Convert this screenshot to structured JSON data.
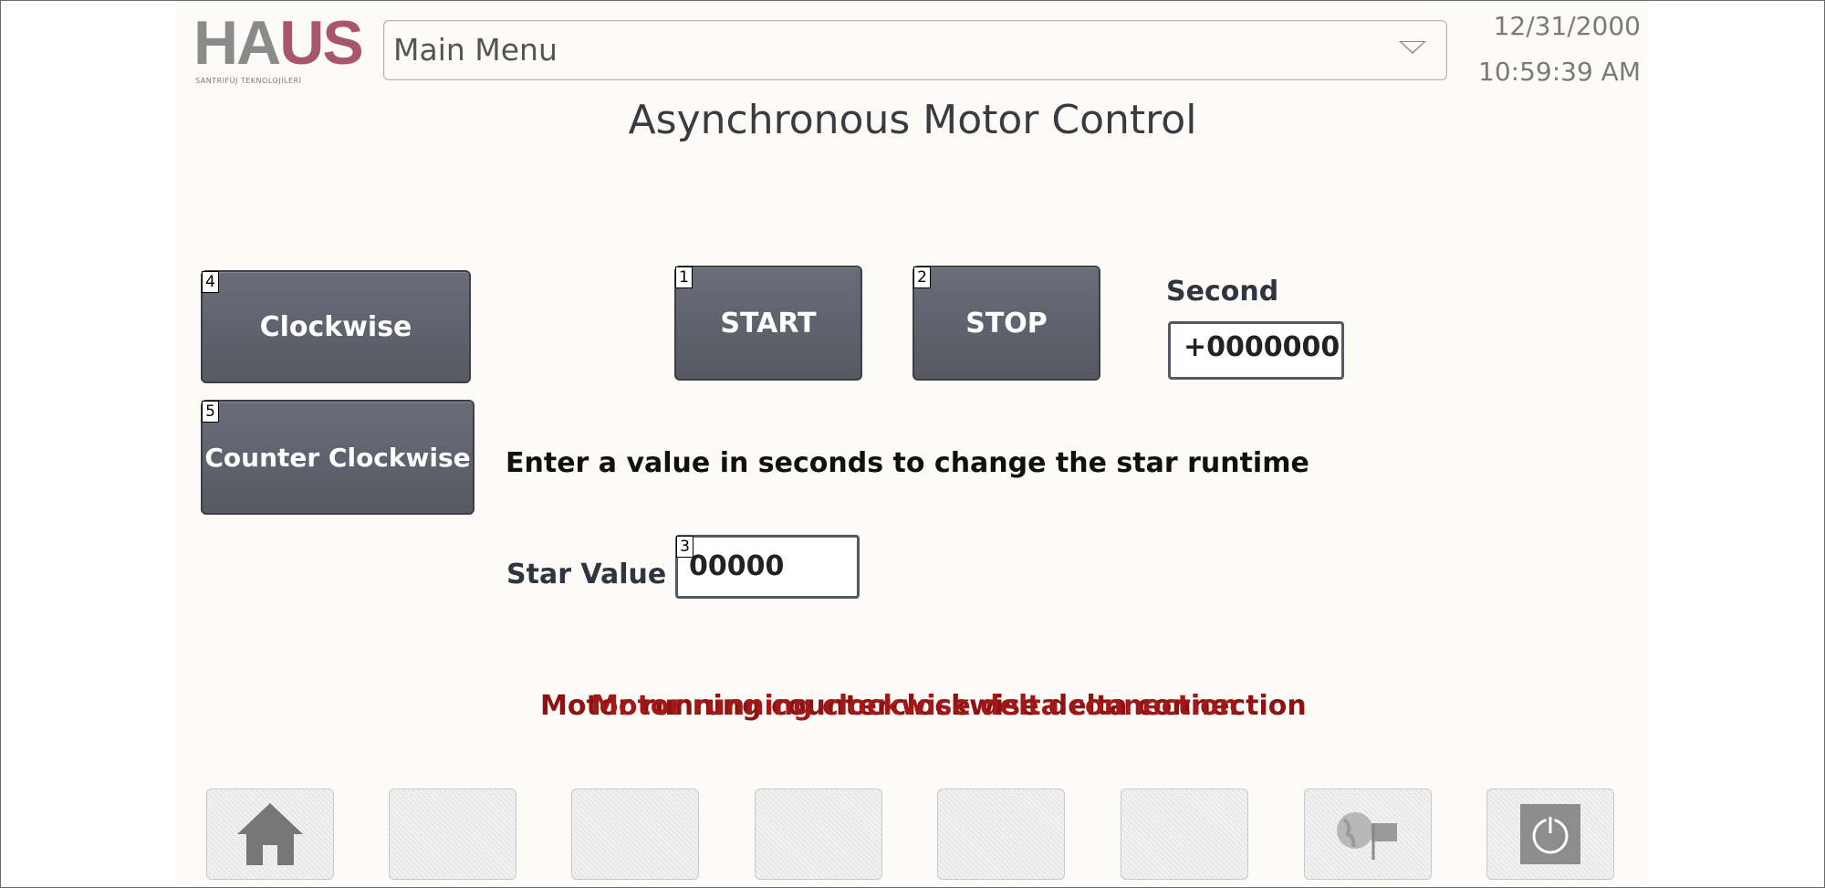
{
  "header": {
    "logo_text_a": "HA",
    "logo_text_b": "US",
    "logo_subtitle": "SANTRIFÜJ TEKNOLOJİLERİ",
    "menu_label": "Main Menu",
    "date": "12/31/2000",
    "time": "10:59:39 AM"
  },
  "title": "Asynchronous Motor Control",
  "buttons": {
    "clockwise": {
      "label": "Clockwise",
      "tag": "4"
    },
    "counter_clockwise": {
      "label": "Counter Clockwise",
      "tag": "5"
    },
    "start": {
      "label": "START",
      "tag": "1"
    },
    "stop": {
      "label": "STOP",
      "tag": "2"
    }
  },
  "second": {
    "label": "Second",
    "value": "+0000000"
  },
  "instruction": "Enter a value in seconds to change the star runtime",
  "star": {
    "label": "Star Value",
    "value": "00000",
    "tag": "3"
  },
  "status": {
    "line_a": "Motor running counterclockwise delta connection",
    "line_b": "Motor running clockwise delta connection"
  },
  "nav_icons": [
    "home-icon",
    "blank",
    "blank",
    "blank",
    "blank",
    "blank",
    "globe-language-icon",
    "power-icon"
  ],
  "colors": {
    "button": "#5f626c",
    "status_text": "#8e1212",
    "logo_red": "#a8566c"
  }
}
